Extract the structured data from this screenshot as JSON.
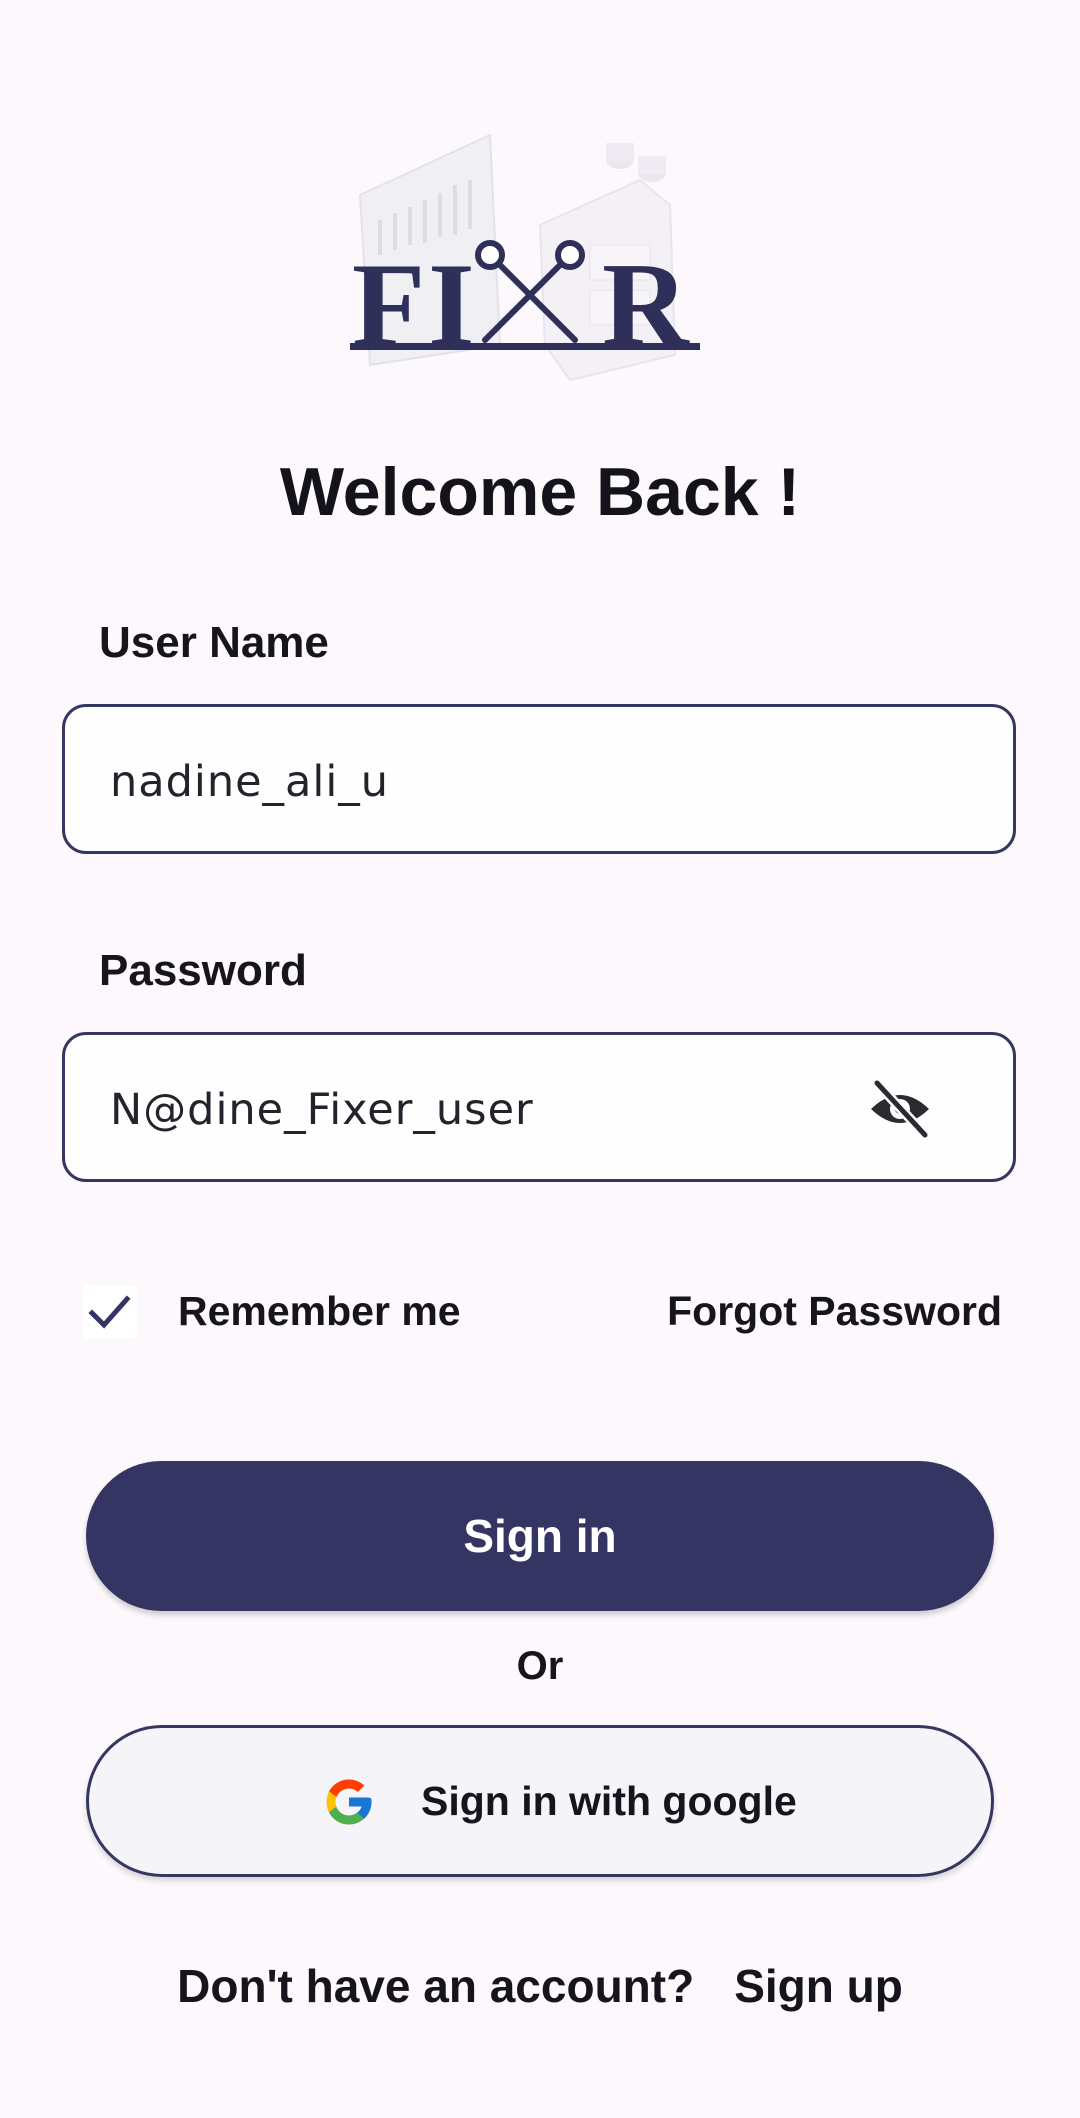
{
  "logo": {
    "text": "FIXR",
    "alt": "Fixer logo"
  },
  "title": "Welcome Back !",
  "username": {
    "label": "User Name",
    "value": "nadine_ali_u"
  },
  "password": {
    "label": "Password",
    "value": "N@dine_Fixer_user",
    "toggle_icon": "eye-off-icon"
  },
  "remember": {
    "label": "Remember me",
    "checked": true
  },
  "forgot_label": "Forgot Password",
  "sign_in_label": "Sign in",
  "or_label": "Or",
  "google_label": "Sign in with google",
  "signup_prompt": "Don't have an account?",
  "signup_link": "Sign up",
  "colors": {
    "primary": "#343563",
    "background": "#fcf8fc",
    "border": "#34375f"
  }
}
